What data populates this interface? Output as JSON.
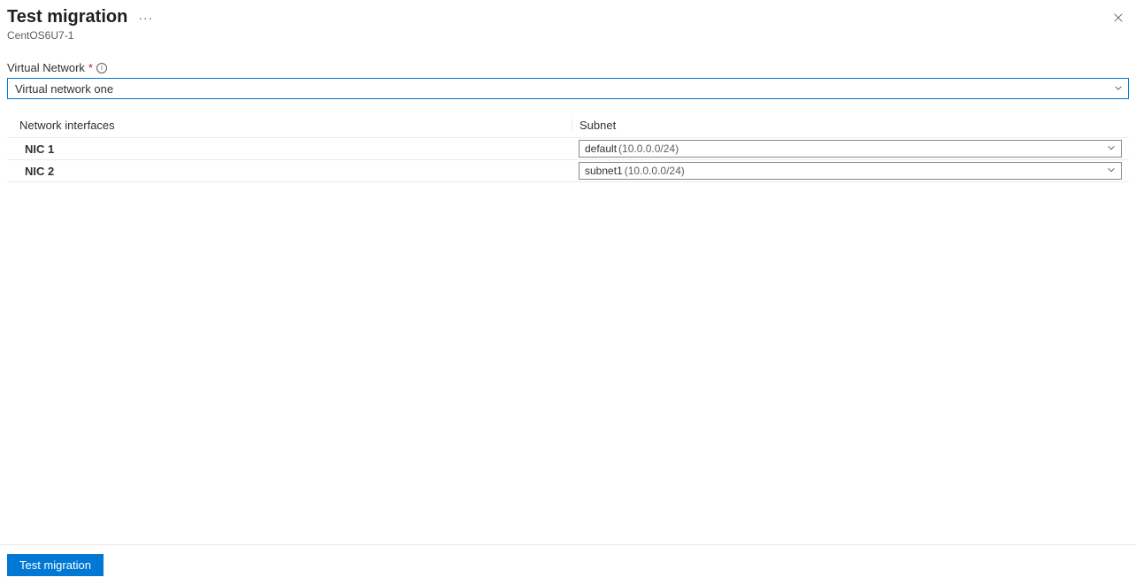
{
  "header": {
    "title": "Test migration",
    "subtitle": "CentOS6U7-1"
  },
  "form": {
    "vnet_label": "Virtual Network",
    "vnet_value": "Virtual network one"
  },
  "table": {
    "col_nic": "Network interfaces",
    "col_subnet": "Subnet",
    "rows": [
      {
        "nic": "NIC 1",
        "subnet_name": "default",
        "subnet_cidr": "(10.0.0.0/24)"
      },
      {
        "nic": "NIC 2",
        "subnet_name": "subnet1",
        "subnet_cidr": "(10.0.0.0/24)"
      }
    ]
  },
  "footer": {
    "primary_label": "Test migration"
  }
}
